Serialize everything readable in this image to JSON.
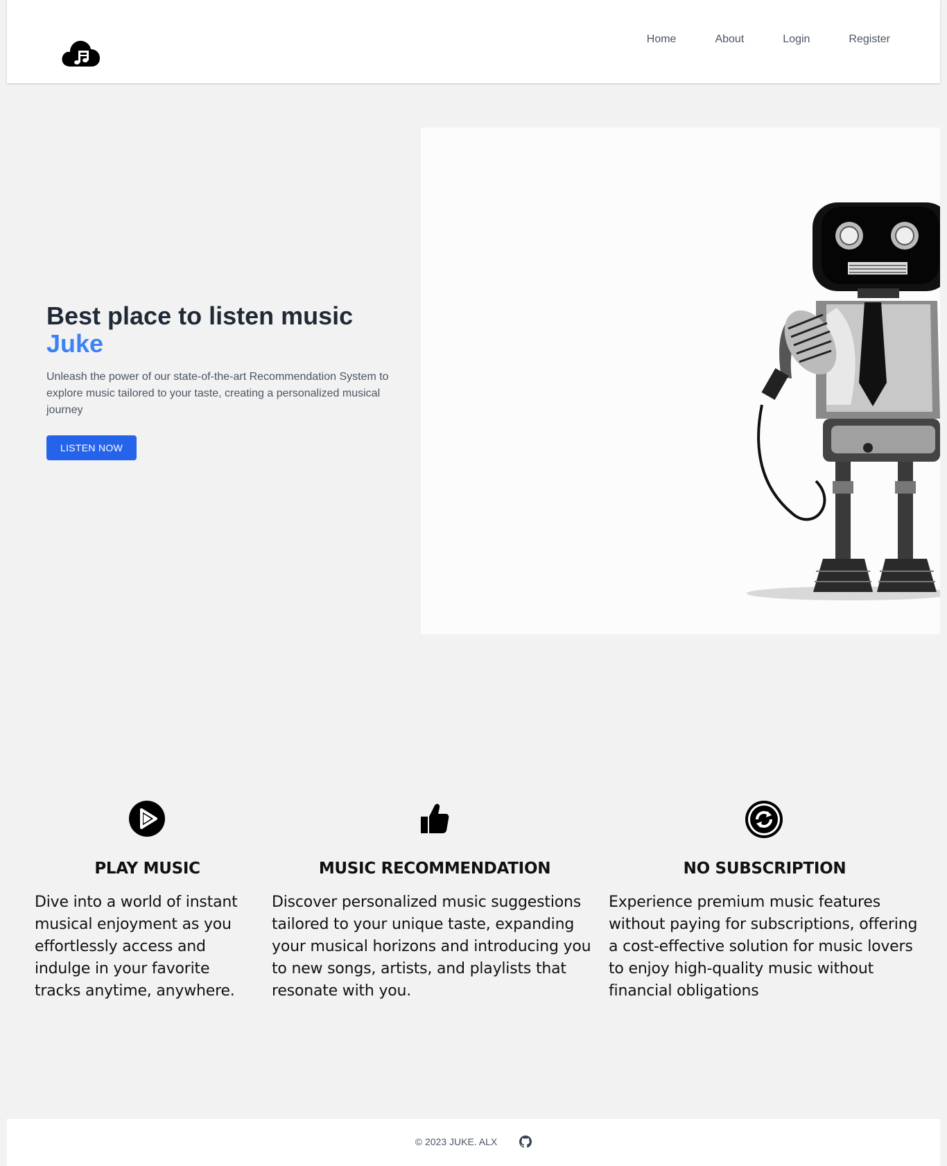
{
  "nav": {
    "logo_icon": "cloud-music-icon",
    "links": [
      "Home",
      "About",
      "Login",
      "Register"
    ]
  },
  "hero": {
    "title": "Best place to listen music",
    "brand": "Juke",
    "description": "Unleash the power of our state-of-the-art Recommendation System to explore music tailored to your taste, creating a personalized musical journey",
    "cta": "LISTEN NOW",
    "image_icon": "robot-microphone-image"
  },
  "features": [
    {
      "icon": "play-circle-icon",
      "title": "PLAY MUSIC",
      "description": "Dive into a world of instant musical enjoyment as you effortlessly access and indulge in your favorite tracks anytime, anywhere."
    },
    {
      "icon": "thumbs-up-icon",
      "title": "MUSIC RECOMMENDATION",
      "description": "Discover personalized music suggestions tailored to your unique taste, expanding your musical horizons and introducing you to new songs, artists, and playlists that resonate with you."
    },
    {
      "icon": "no-subscription-icon",
      "title": "NO SUBSCRIPTION",
      "description": "Experience premium music features without paying for subscriptions, offering a cost-effective solution for music lovers to enjoy high-quality music without financial obligations"
    }
  ],
  "footer": {
    "copyright": "© 2023 JUKE. ALX",
    "github_icon": "github-icon"
  },
  "colors": {
    "accent": "#2563eb",
    "brand_text": "#3b82f6",
    "background": "#f2f2f2"
  }
}
